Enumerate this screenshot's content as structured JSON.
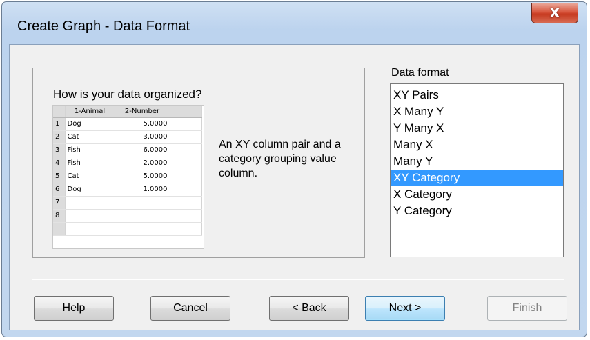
{
  "window": {
    "title": "Create Graph - Data Format",
    "close_glyph": "X"
  },
  "preview": {
    "question": "How is your data organized?",
    "columns": [
      "1-Animal",
      "2-Number"
    ],
    "rows": [
      {
        "num": "1",
        "animal": "Dog",
        "number": "5.0000"
      },
      {
        "num": "2",
        "animal": "Cat",
        "number": "3.0000"
      },
      {
        "num": "3",
        "animal": "Fish",
        "number": "6.0000"
      },
      {
        "num": "4",
        "animal": "Fish",
        "number": "2.0000"
      },
      {
        "num": "5",
        "animal": "Cat",
        "number": "5.0000"
      },
      {
        "num": "6",
        "animal": "Dog",
        "number": "1.0000"
      },
      {
        "num": "7",
        "animal": "",
        "number": ""
      },
      {
        "num": "8",
        "animal": "",
        "number": ""
      },
      {
        "num": "",
        "animal": "",
        "number": ""
      }
    ],
    "description": "An XY column pair and a category grouping value column."
  },
  "data_format": {
    "label_accel": "D",
    "label_rest": "ata format",
    "items": [
      "XY Pairs",
      "X Many Y",
      "Y Many X",
      "Many X",
      "Many Y",
      "XY Category",
      "X Category",
      "Y Category"
    ],
    "selected": "XY Category"
  },
  "buttons": {
    "help": "Help",
    "cancel": "Cancel",
    "back_prefix": "< ",
    "back_accel": "B",
    "back_rest": "ack",
    "next": "Next >",
    "finish": "Finish"
  },
  "colors": {
    "selection": "#3399ff",
    "close_button": "#c63a20"
  }
}
